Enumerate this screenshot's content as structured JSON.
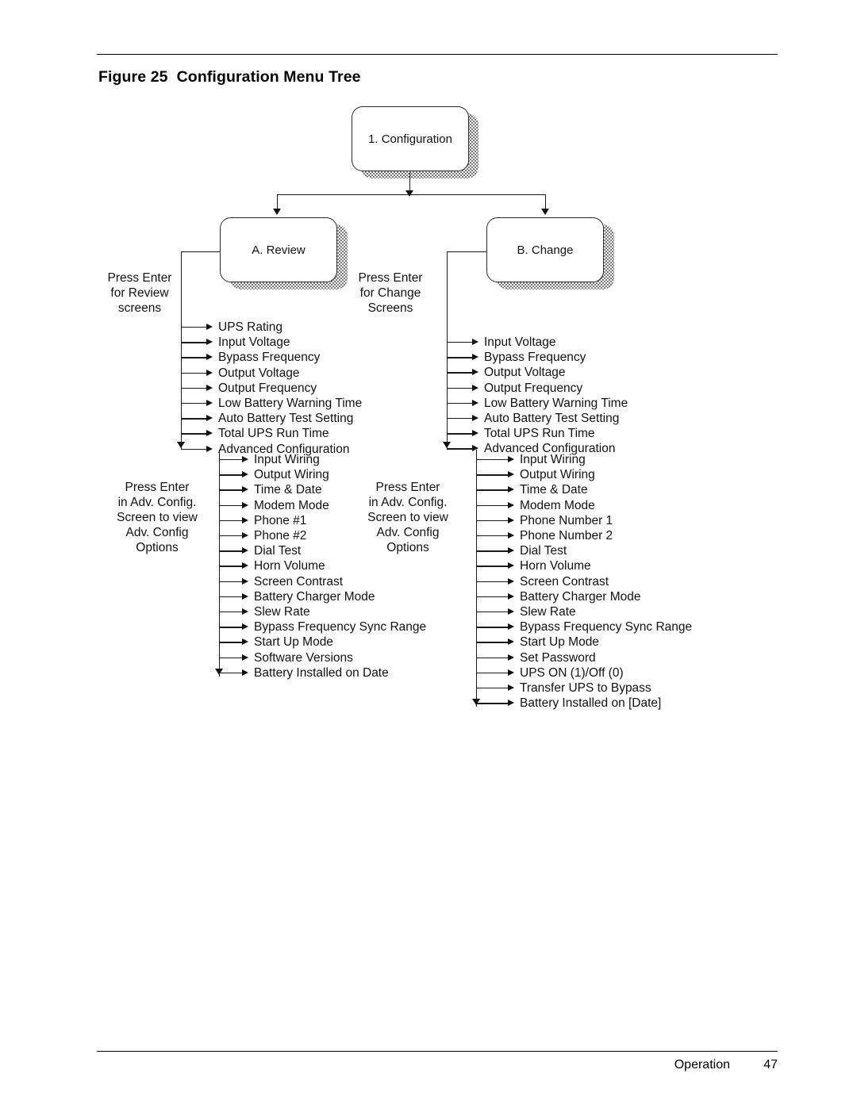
{
  "page": {
    "figure_caption": "Figure 25  Configuration Menu Tree",
    "footer_section": "Operation",
    "footer_page": "47"
  },
  "diagram": {
    "root": {
      "label": "1. Configuration"
    },
    "branches": [
      {
        "id": "review",
        "label": "A. Review"
      },
      {
        "id": "change",
        "label": "B. Change"
      }
    ],
    "annotations": {
      "review_enter": "Press Enter\nfor Review\nscreens",
      "change_enter": "Press Enter\nfor Change\nScreens",
      "review_adv": "Press Enter\nin Adv. Config.\nScreen to view\nAdv. Config\nOptions",
      "change_adv": "Press Enter\nin Adv. Config.\nScreen to view\nAdv. Config\nOptions"
    },
    "review_items": [
      "UPS Rating",
      "Input Voltage",
      "Bypass Frequency",
      "Output Voltage",
      "Output Frequency",
      "Low Battery Warning Time",
      "Auto Battery Test Setting",
      "Total UPS Run Time",
      "Advanced Configuration"
    ],
    "review_adv_items": [
      "Input Wiring",
      "Output Wiring",
      "Time & Date",
      "Modem Mode",
      "Phone #1",
      "Phone #2",
      "Dial Test",
      "Horn Volume",
      "Screen Contrast",
      "Battery Charger Mode",
      "Slew Rate",
      "Bypass Frequency Sync Range",
      "Start Up Mode",
      "Software Versions",
      "Battery Installed on Date"
    ],
    "change_items": [
      "Input Voltage",
      "Bypass Frequency",
      "Output Voltage",
      "Output Frequency",
      "Low Battery Warning Time",
      "Auto Battery Test Setting",
      "Total UPS Run Time",
      "Advanced Configuration"
    ],
    "change_adv_items": [
      "Input Wiring",
      "Output Wiring",
      "Time & Date",
      "Modem Mode",
      "Phone Number 1",
      "Phone Number 2",
      "Dial Test",
      "Horn Volume",
      "Screen Contrast",
      "Battery Charger Mode",
      "Slew Rate",
      "Bypass Frequency Sync Range",
      "Start Up Mode",
      "Set Password",
      "UPS ON (1)/Off (0)",
      "Transfer UPS to Bypass",
      "Battery Installed on [Date]"
    ]
  }
}
